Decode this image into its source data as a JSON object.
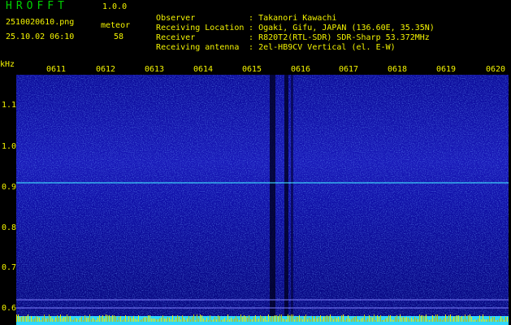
{
  "app": {
    "title": "HROFFT",
    "version": "1.0.0"
  },
  "file_name": "2510020610.png",
  "date_time": "25.10.02 06:10",
  "meteor": {
    "label": "meteor",
    "count": "58"
  },
  "meta": [
    {
      "key": "Observer",
      "value": ": Takanori Kawachi"
    },
    {
      "key": "Receiving Location",
      "value": ": Ogaki, Gifu, JAPAN (136.60E, 35.35N)"
    },
    {
      "key": "Receiver",
      "value": ": R820T2(RTL-SDR) SDR-Sharp 53.372MHz"
    },
    {
      "key": "Receiving antenna",
      "value": ": 2el-HB9CV Vertical (el. E-W)"
    }
  ],
  "axis": {
    "freq_unit": "kHz",
    "time_ticks": [
      "0611",
      "0612",
      "0613",
      "0614",
      "0615",
      "0616",
      "0617",
      "0618",
      "0619",
      "0620"
    ],
    "freq_ticks": [
      "1.1",
      "1.0",
      "0.9",
      "0.8",
      "0.7",
      "0.6"
    ]
  },
  "colors": {
    "background": "#000000",
    "label_yellow": "#f4f400",
    "title_green": "#00d000",
    "plot_blue": "#0a0aa0",
    "carrier_cyan": "#40e0ff"
  }
}
